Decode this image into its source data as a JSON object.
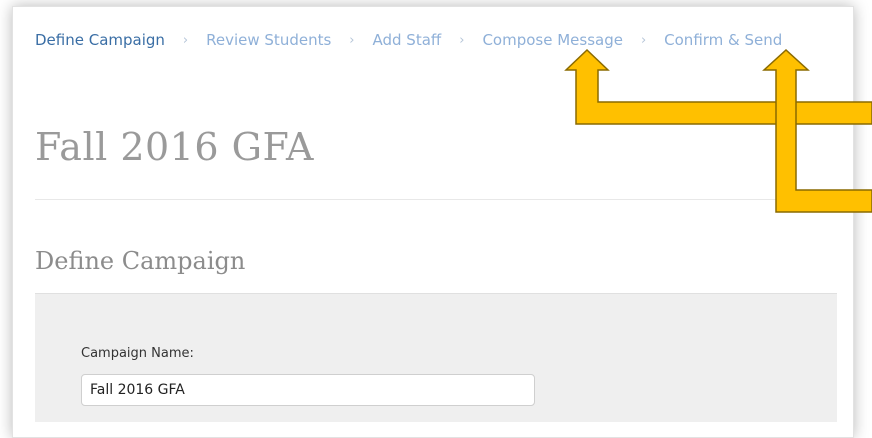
{
  "wizard": {
    "steps": [
      {
        "label": "Define Campaign",
        "active": true
      },
      {
        "label": "Review Students",
        "active": false
      },
      {
        "label": "Add Staff",
        "active": false
      },
      {
        "label": "Compose Message",
        "active": false
      },
      {
        "label": "Confirm & Send",
        "active": false
      }
    ],
    "separator": "›"
  },
  "page": {
    "title": "Fall 2016 GFA"
  },
  "section": {
    "title": "Define Campaign"
  },
  "form": {
    "campaign_name_label": "Campaign Name:",
    "campaign_name_value": "Fall 2016 GFA"
  },
  "annotation": {
    "arrow_color": "#ffc000",
    "arrow_outline": "#8a6a00"
  },
  "theme": {
    "active_step": "#3a6ea5",
    "inactive_step": "#8fb0d8",
    "heading_gray": "#9a9a9a",
    "panel_bg": "#efefef"
  }
}
